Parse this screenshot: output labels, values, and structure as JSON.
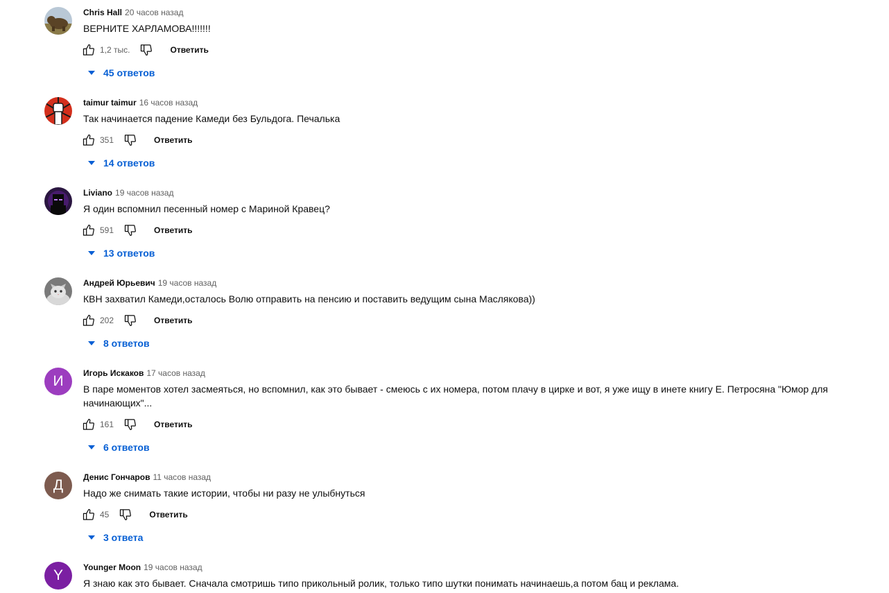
{
  "labels": {
    "reply": "Ответить"
  },
  "comments": [
    {
      "author": "Chris Hall",
      "time": "20 часов назад",
      "text": "ВЕРНИТЕ ХАРЛАМОВА!!!!!!!",
      "likes": "1,2 тыс.",
      "replies": "45 ответов",
      "avatar": {
        "type": "image",
        "icon": "bear-photo-icon",
        "color": "#8a7a48"
      }
    },
    {
      "author": "taimur taimur",
      "time": "16 часов назад",
      "text": "Так начинается падение Камеди без Бульдога. Печалька",
      "likes": "351",
      "replies": "14 ответов",
      "avatar": {
        "type": "image",
        "icon": "raised-fist-icon",
        "color": "#d32f1c"
      }
    },
    {
      "author": "Liviano",
      "time": "19 часов назад",
      "text": "Я один вспомнил песенный номер с Мариной Кравец?",
      "likes": "591",
      "replies": "13 ответов",
      "avatar": {
        "type": "image",
        "icon": "dark-character-icon",
        "color": "#2a1640"
      }
    },
    {
      "author": "Андрей Юрьевич",
      "time": "19 часов назад",
      "text": "КВН захватил Камеди,осталось Волю отправить на пенсию и поставить ведущим сына Маслякова))",
      "likes": "202",
      "replies": "8 ответов",
      "avatar": {
        "type": "image",
        "icon": "cat-photo-icon",
        "color": "#9a9a9a"
      }
    },
    {
      "author": "Игорь Искаков",
      "time": "17 часов назад",
      "text": "В паре моментов хотел засмеяться, но вспомнил, как это бывает - смеюсь с их номера, потом плачу в цирке и вот, я уже ищу в инете книгу Е. Петросяна \"Юмор для начинающих\"...",
      "likes": "161",
      "replies": "6 ответов",
      "avatar": {
        "type": "letter",
        "letter": "И",
        "color": "#9c3dbf"
      }
    },
    {
      "author": "Денис Гончаров",
      "time": "11 часов назад",
      "text": "Надо же снимать такие истории, чтобы ни разу не улыбнуться",
      "likes": "45",
      "replies": "3 ответа",
      "avatar": {
        "type": "letter",
        "letter": "Д",
        "color": "#7d5b4f"
      }
    },
    {
      "author": "Younger Moon",
      "time": "19 часов назад",
      "text": "Я знаю как это бывает. Сначала смотришь типо прикольный ролик, только типо шутки понимать начинаешь,а потом бац и реклама.",
      "likes": "",
      "replies": "",
      "avatar": {
        "type": "letter",
        "letter": "Y",
        "color": "#7b1fa2"
      }
    }
  ]
}
